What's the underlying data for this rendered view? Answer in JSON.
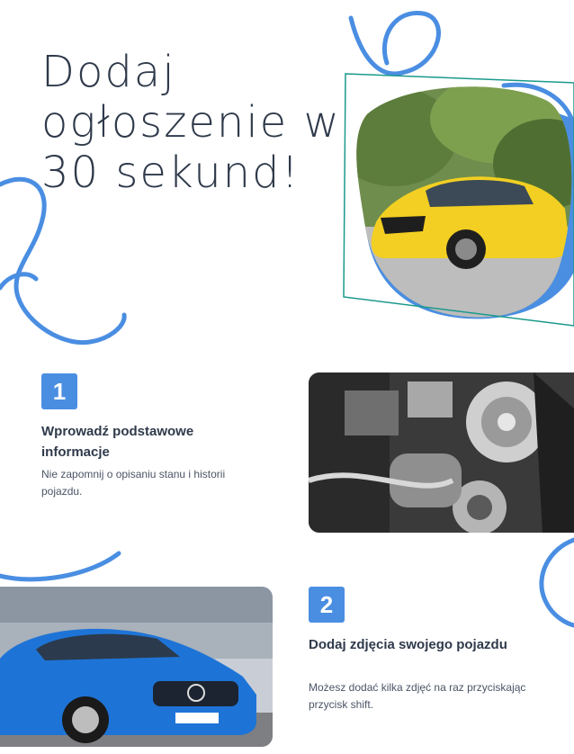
{
  "hero": {
    "title": "Dodaj ogłoszenie w 30 sekund!"
  },
  "steps": [
    {
      "number": "1",
      "title": "Wprowadź podstawowe informacje",
      "description": "Nie zapomnij o opisaniu stanu i historii pojazdu."
    },
    {
      "number": "2",
      "title": "Dodaj zdjęcia swojego pojazdu",
      "description": "Możesz dodać kilka zdjęć na raz przyciskając przycisk shift."
    }
  ],
  "colors": {
    "accent": "#4a8ee2",
    "heading": "#2f3a4b",
    "teal_frame": "#1a9a8a"
  }
}
